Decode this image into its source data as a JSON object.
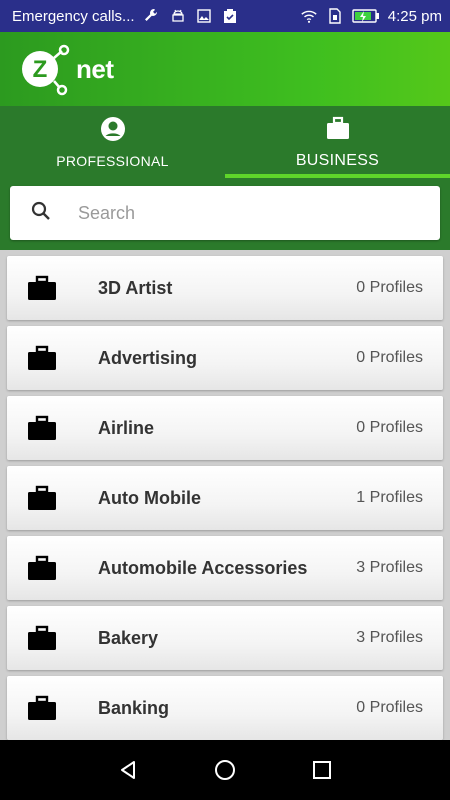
{
  "status_bar": {
    "carrier_text": "Emergency calls...",
    "time": "4:25 pm",
    "left_icons": [
      "wrench-icon",
      "android-icon",
      "image-icon",
      "clipboard-check-icon"
    ],
    "right_icons": [
      "wifi-icon",
      "sim-icon",
      "battery-charging-icon"
    ]
  },
  "header": {
    "logo_letter": "Z",
    "logo_text": "net",
    "brand_color": "#3fbf1f"
  },
  "tabs": [
    {
      "label": "PROFESSIONAL",
      "icon": "person-icon",
      "active": false
    },
    {
      "label": "BUSINESS",
      "icon": "briefcase-icon",
      "active": true
    }
  ],
  "search": {
    "placeholder": "Search",
    "value": ""
  },
  "categories": [
    {
      "title": "3D Artist",
      "count": "0 Profiles"
    },
    {
      "title": "Advertising",
      "count": "0 Profiles"
    },
    {
      "title": "Airline",
      "count": "0 Profiles"
    },
    {
      "title": "Auto Mobile",
      "count": "1 Profiles"
    },
    {
      "title": "Automobile Accessories",
      "count": "3 Profiles"
    },
    {
      "title": "Bakery",
      "count": "3 Profiles"
    },
    {
      "title": "Banking",
      "count": "0 Profiles"
    }
  ],
  "nav": {
    "icons": [
      "back-icon",
      "home-icon",
      "recents-icon"
    ]
  },
  "colors": {
    "status_bar": "#2a2f8a",
    "tab_bar": "#2b7a2b",
    "tab_indicator": "#5fd52a"
  }
}
